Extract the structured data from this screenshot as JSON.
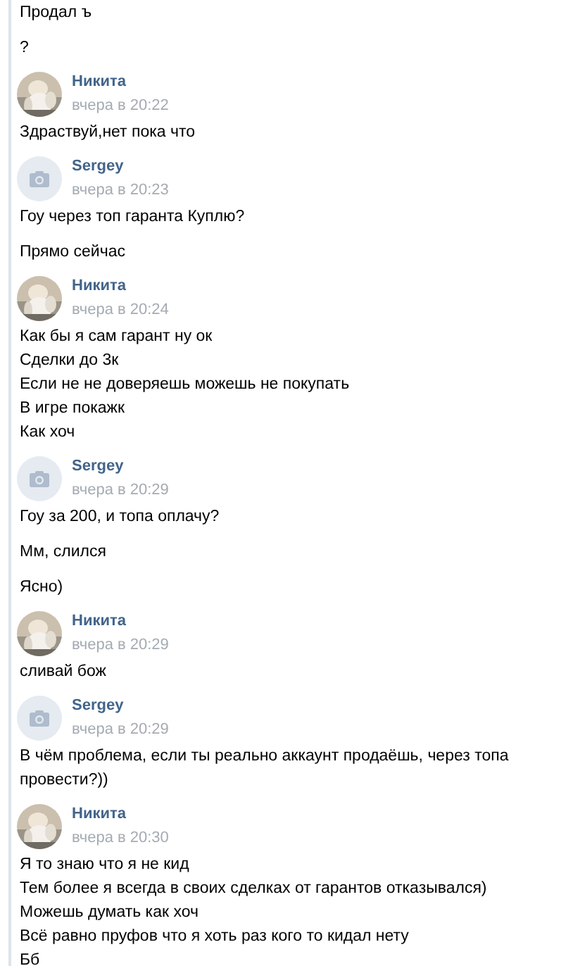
{
  "feed": [
    {
      "kind": "message",
      "lines": [
        "Продал ъ"
      ]
    },
    {
      "kind": "message",
      "lines": [
        "?"
      ]
    },
    {
      "kind": "header",
      "author": "Никита",
      "time": "вчера в 20:22"
    },
    {
      "kind": "message",
      "lines": [
        "Здраствуй,нет пока что"
      ]
    },
    {
      "kind": "header",
      "avatar": {
        "kind": "camera"
      },
      "author": "Sergey",
      "time": "вчера в 20:23"
    },
    {
      "kind": "message",
      "lines": [
        "Гоу через топ гаранта Куплю?"
      ]
    },
    {
      "kind": "message",
      "lines": [
        "Прямо сейчас"
      ]
    },
    {
      "kind": "header",
      "author": "Никита",
      "time": "вчера в 20:24"
    },
    {
      "kind": "message",
      "lines": [
        "Как бы я сам гарант ну ок",
        "Сделки до 3к",
        "Если не не доверяешь можешь не покупать",
        "В игре покажк",
        "Как хоч"
      ]
    },
    {
      "kind": "header",
      "avatar": {
        "kind": "camera"
      },
      "author": "Sergey",
      "time": "вчера в 20:29"
    },
    {
      "kind": "message",
      "lines": [
        "Гоу за 200, и топа оплачу?"
      ]
    },
    {
      "kind": "message",
      "lines": [
        "Мм, слился"
      ]
    },
    {
      "kind": "message",
      "lines": [
        "Ясно)"
      ]
    },
    {
      "kind": "header",
      "author": "Никита",
      "time": "вчера в 20:29"
    },
    {
      "kind": "message",
      "lines": [
        "сливай бож"
      ]
    },
    {
      "kind": "header",
      "avatar": {
        "kind": "camera"
      },
      "author": "Sergey",
      "time": "вчера в 20:29"
    },
    {
      "kind": "message",
      "lines": [
        "В чём проблема, если ты реально аккаунт продаёшь, через топа провести?))"
      ]
    },
    {
      "kind": "header",
      "author": "Никита",
      "time": "вчера в 20:30"
    },
    {
      "kind": "message",
      "lines": [
        "Я то знаю что я не кид",
        "Тем более я всегда в своих сделках от гарантов отказывался)",
        "Можешь думать как хоч",
        "Всё равно пруфов что я хоть раз кого то кидал нету",
        "Бб"
      ]
    }
  ]
}
